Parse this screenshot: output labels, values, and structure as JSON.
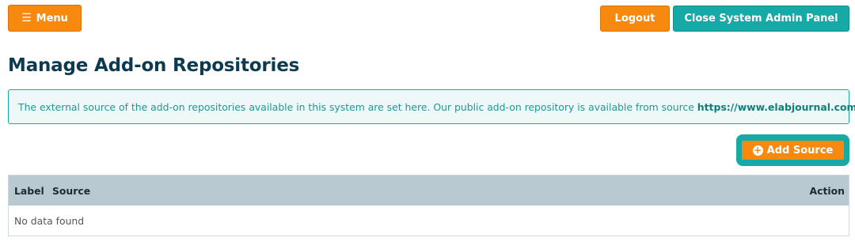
{
  "header": {
    "menu_label": "Menu",
    "logout_label": "Logout",
    "close_panel_label": "Close System Admin Panel"
  },
  "page": {
    "title": "Manage Add-on Repositories",
    "info_text": "The external source of the add-on repositories available in this system are set here. Our public add-on repository is available from source ",
    "info_link": "https://www.elabjournal.com",
    "info_suffix": "."
  },
  "toolbar": {
    "add_source_label": "Add Source"
  },
  "table": {
    "columns": [
      "Label",
      "Source",
      "Action"
    ],
    "empty_text": "No data found"
  },
  "colors": {
    "orange": "#f7890e",
    "teal": "#17a9a6",
    "title": "#0d3a4e"
  }
}
